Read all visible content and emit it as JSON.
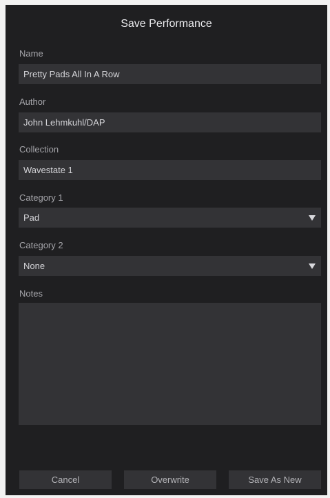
{
  "dialog": {
    "title": "Save Performance"
  },
  "fields": {
    "name": {
      "label": "Name",
      "value": "Pretty Pads All In A Row"
    },
    "author": {
      "label": "Author",
      "value": "John Lehmkuhl/DAP"
    },
    "collection": {
      "label": "Collection",
      "value": "Wavestate 1"
    },
    "category1": {
      "label": "Category 1",
      "value": "Pad"
    },
    "category2": {
      "label": "Category 2",
      "value": "None"
    },
    "notes": {
      "label": "Notes",
      "value": ""
    }
  },
  "buttons": {
    "cancel": "Cancel",
    "overwrite": "Overwrite",
    "save_as_new": "Save As New"
  },
  "icons": {
    "dropdown": "dropdown-arrow-icon"
  },
  "colors": {
    "dialog_bg": "#1f1f21",
    "field_bg": "#333336",
    "title_text": "#ececef",
    "label_text": "#a5a5aa"
  }
}
